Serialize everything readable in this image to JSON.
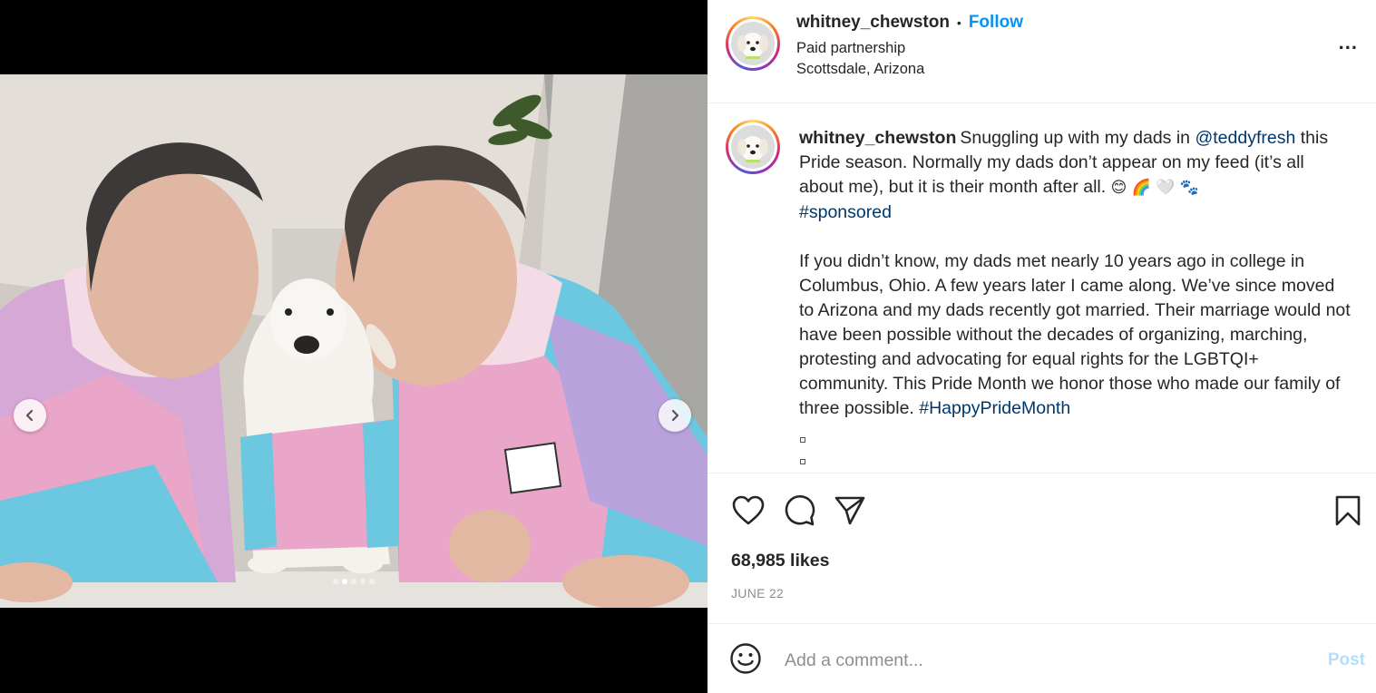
{
  "post": {
    "username": "whitney_chewston",
    "follow_separator": "•",
    "follow_label": "Follow",
    "paid_partnership": "Paid partnership",
    "location": "Scottsdale, Arizona",
    "more_label": "..."
  },
  "caption": {
    "username": "whitney_chewston",
    "line1": "Snuggling up with my dads in ",
    "mention": "@teddyfresh",
    "line2": " this Pride season. Normally my dads don’t appear on my feed (it’s all about me), but it is their month after all. ",
    "emojis": "😊 🌈 🤍 🐾",
    "hashtag_sponsored": "#sponsored",
    "paragraph2": "If you didn’t know, my dads met nearly 10 years ago in college in Columbus, Ohio. A few years later I came along. We’ve since moved to Arizona and my dads recently got married. Their marriage would not have been possible without the decades of organizing, marching, protesting and advocating for equal rights for the LGBTQI+ community. This Pride Month we honor those who made our family of three possible. ",
    "hashtag_pride": "#HappyPrideMonth"
  },
  "stats": {
    "likes": "68,985 likes",
    "date": "JUNE 22"
  },
  "comment": {
    "placeholder": "Add a comment...",
    "post_label": "Post"
  },
  "carousel": {
    "slide_count": 5,
    "active_slide": 2
  },
  "colors": {
    "follow": "#0095f6",
    "link": "#00376b",
    "post_disabled": "#b2dffc",
    "hoodie_pink": "#e9a6c8",
    "hoodie_blue": "#6cc7e0",
    "hoodie_lilac": "#b9a3dc"
  }
}
